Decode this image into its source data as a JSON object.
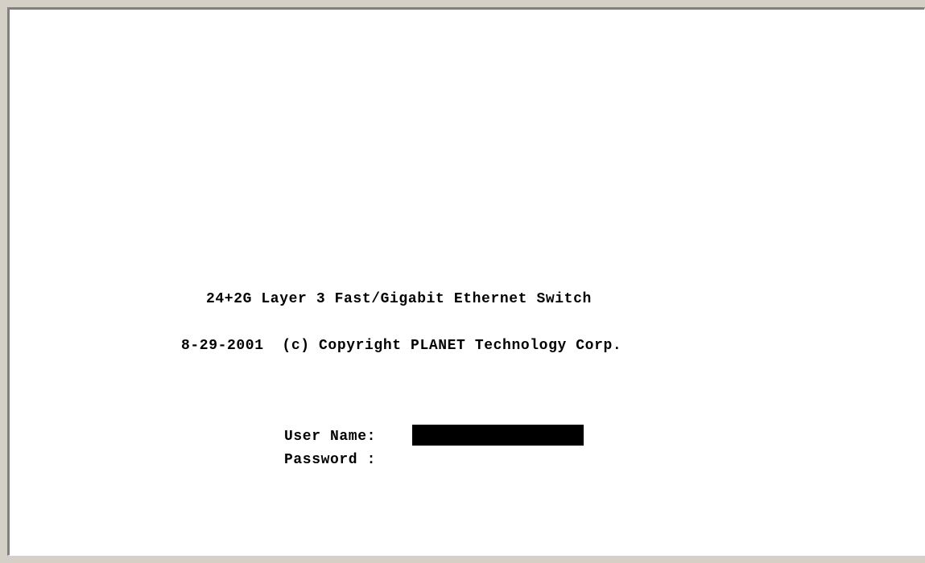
{
  "console": {
    "title": "24+2G Layer 3 Fast/Gigabit Ethernet Switch",
    "copyright": "8-29-2001  (c) Copyright PLANET Technology Corp.",
    "login": {
      "username_label": "User Name:",
      "username_value": "",
      "password_label": "Password :",
      "password_value": ""
    }
  },
  "colors": {
    "terminal_background": "#ffffff",
    "text": "#000000",
    "active_field": "#000000",
    "frame": "#d4d0c8"
  }
}
